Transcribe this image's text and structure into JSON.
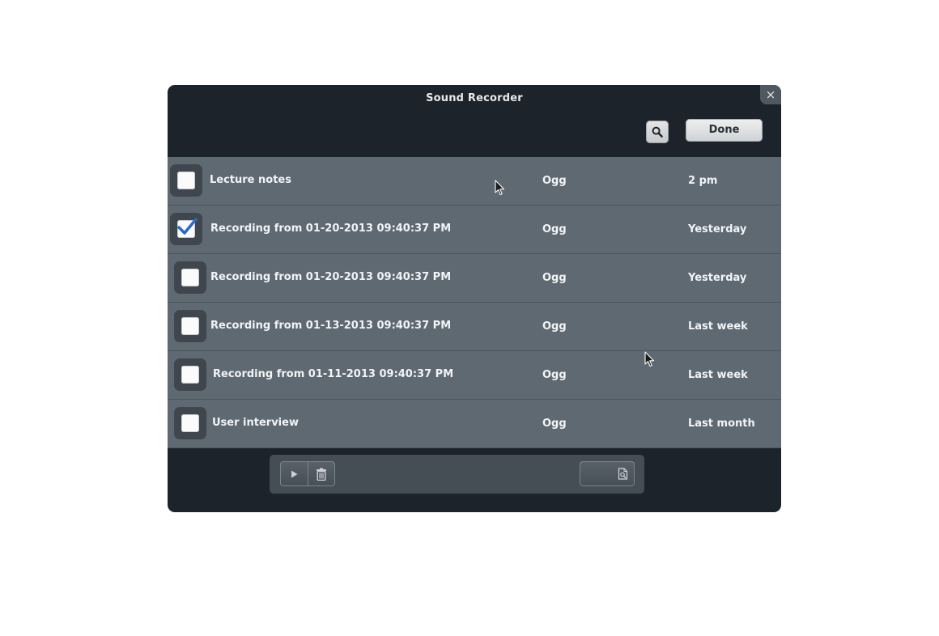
{
  "window": {
    "title": "Sound Recorder",
    "close_label": "×"
  },
  "header": {
    "search_icon": "magnifier-icon",
    "done_label": "Done"
  },
  "recordings": [
    {
      "name": "Lecture notes",
      "format": "Ogg",
      "date": "2 pm",
      "checked": false
    },
    {
      "name": "Recording from 01-20-2013 09:40:37 PM",
      "format": "Ogg",
      "date": "Yesterday",
      "checked": true
    },
    {
      "name": "Recording from 01-20-2013 09:40:37 PM",
      "format": "Ogg",
      "date": "Yesterday",
      "checked": false
    },
    {
      "name": "Recording from 01-13-2013 09:40:37 PM",
      "format": "Ogg",
      "date": "Last week",
      "checked": false
    },
    {
      "name": "Recording from 01-11-2013 09:40:37 PM",
      "format": "Ogg",
      "date": "Last week",
      "checked": false
    },
    {
      "name": "User interview",
      "format": "Ogg",
      "date": "Last month",
      "checked": false
    }
  ],
  "toolbar": {
    "play_icon": "play-icon",
    "delete_icon": "trash-icon",
    "export_icon": "export-file-icon"
  },
  "colors": {
    "window_bg": "#1d232a",
    "row_bg": "#5e6972",
    "checkmark": "#2a6cc4"
  }
}
